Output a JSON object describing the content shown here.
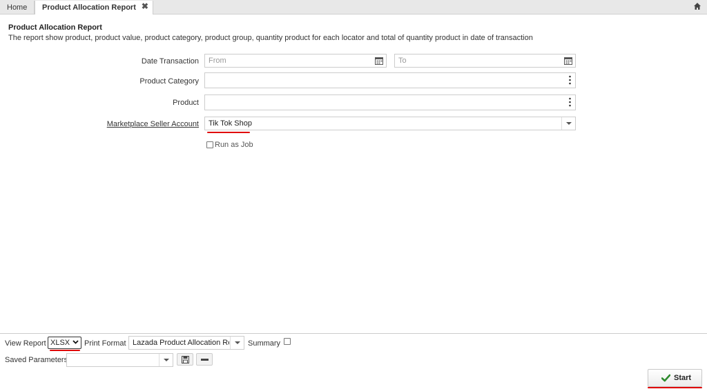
{
  "tabs": [
    {
      "label": "Home"
    },
    {
      "label": "Product Allocation Report"
    }
  ],
  "report": {
    "title": "Product Allocation Report",
    "description": "The report show product, product value, product category, product group, quantity product for each locator and total of quantity product in date of transaction"
  },
  "form": {
    "date_label": "Date Transaction",
    "date_from_placeholder": "From",
    "date_to_placeholder": "To",
    "category_label": "Product Category",
    "category_value": "",
    "product_label": "Product",
    "product_value": "",
    "marketplace_label": "Marketplace Seller Account",
    "marketplace_value": "Tik Tok Shop",
    "run_as_job_label": "Run as Job",
    "run_as_job_checked": false
  },
  "bottom": {
    "view_report_label": "View Report",
    "view_report_value": "XLSX",
    "print_format_label": "Print Format",
    "print_format_value": "Lazada Product Allocation Re",
    "summary_label": "Summary",
    "summary_checked": false,
    "saved_params_label": "Saved Parameters",
    "saved_params_value": "",
    "start_label": "Start"
  },
  "icons": {
    "close": "close-icon",
    "home": "home-icon",
    "calendar": "calendar-icon",
    "more": "vertical-dots-icon",
    "dropdown": "chevron-down-icon",
    "save": "floppy-disk-icon",
    "remove": "minus-icon",
    "check": "checkmark-icon"
  },
  "colors": {
    "annotation_red": "#e00000",
    "check_green": "#2e8b2e",
    "tab_bar": "#e8e8e8",
    "link_label": "#333333"
  }
}
